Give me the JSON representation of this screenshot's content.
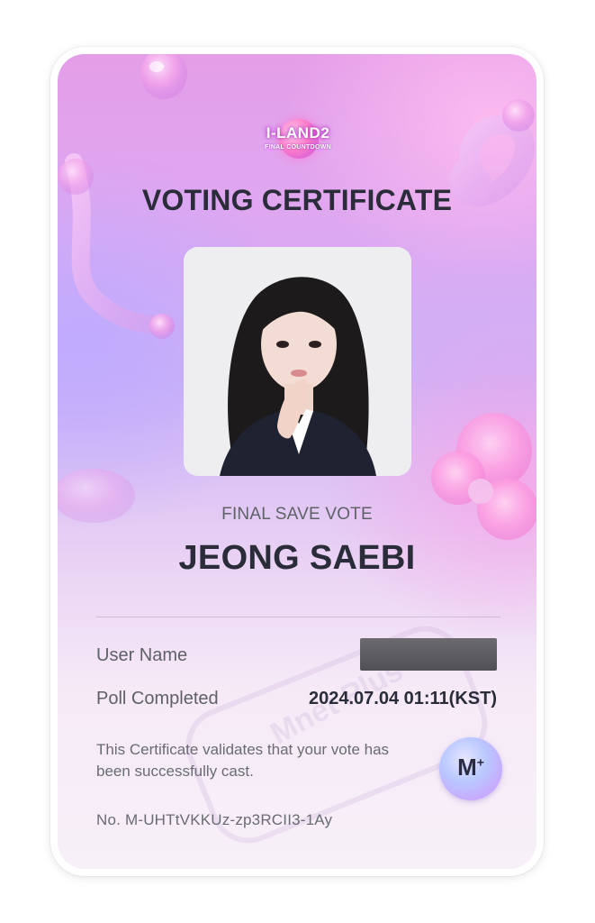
{
  "logo": {
    "text": "I-LAND2",
    "subtitle": "FINAL COUNTDOWN"
  },
  "certificate": {
    "title": "VOTING CERTIFICATE",
    "category": "FINAL SAVE VOTE",
    "candidate": "JEONG SAEBI",
    "notice": "This Certificate validates that your vote has been successfully cast.",
    "number": "No. M-UHTtVKKUz-zp3RCII3-1Ay"
  },
  "details": {
    "user_name_label": "User Name",
    "user_name_value": "",
    "poll_completed_label": "Poll Completed",
    "poll_completed_value": "2024.07.04 01:11(KST)"
  },
  "watermark": "Mnet Plus",
  "mnet_button_icon": "mnet-plus-icon",
  "colors": {
    "title": "#2b2c3a",
    "label": "#5f6068",
    "gradient_top": "#e49ee8",
    "gradient_mid": "#cdb2f6",
    "gradient_bottom": "#f7f0f8"
  }
}
